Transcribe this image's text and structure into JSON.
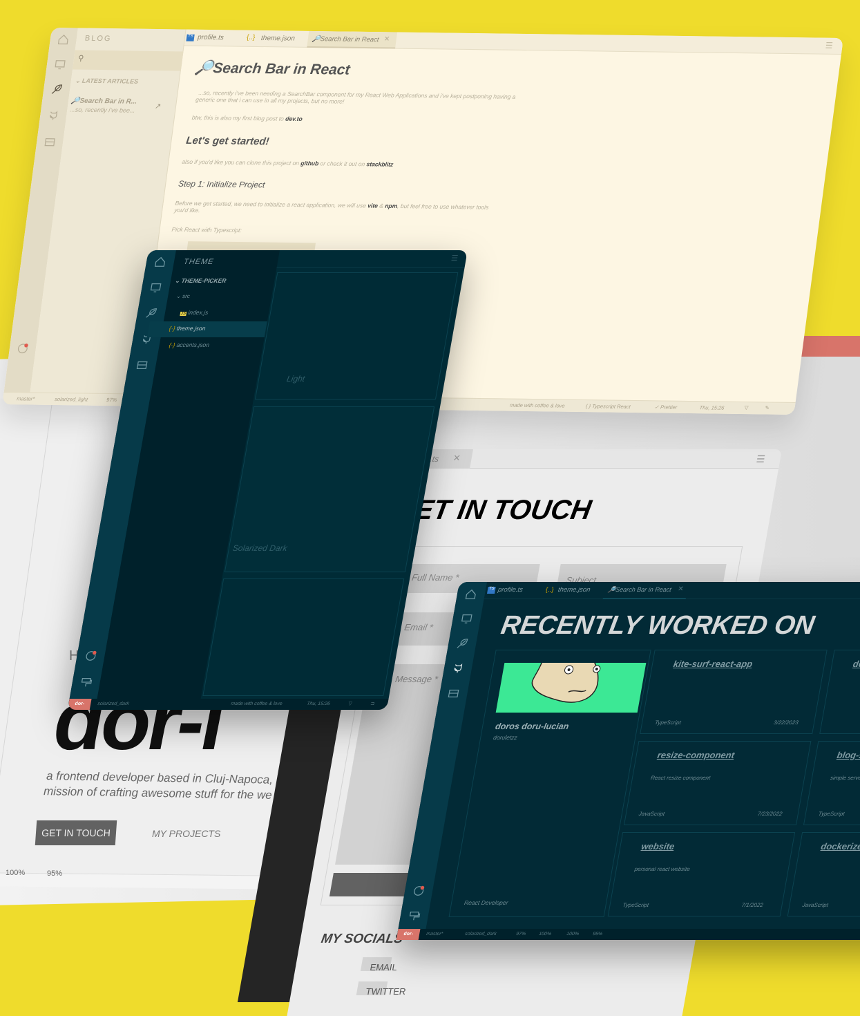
{
  "blog_window": {
    "sidebar_title": "BLOG",
    "section": "LATEST ARTICLES",
    "article": {
      "title": "Search Bar in R...",
      "excerpt": "...so, recently i've bee..."
    },
    "tabs": [
      {
        "label": "profile.ts"
      },
      {
        "label": "theme.json"
      },
      {
        "label": "Search Bar in React"
      }
    ],
    "title": "Search Bar in React",
    "intro": "...so, recently i've been needing a SearchBar component for my React Web Applications and i've kept postponing having a",
    "intro2": "generic one that i can use in all my projects, but no more!",
    "btw": "btw, this is also my first blog post to",
    "btw_link": "dev.to",
    "h2": "Let's get started!",
    "clone_a": "also if you'd like you can clone this project on",
    "clone_link1": "github",
    "clone_b": "or check it out on",
    "clone_link2": "stackblitz",
    "h3": "Step 1: Initialize Project",
    "before_a": "Before we get started, we need to initialize a react application, we will use",
    "before_vite": "vite",
    "before_amp": "&",
    "before_npm": "npm",
    "before_b": ", but feel free to use whatever tools",
    "before_c": "you'd like.",
    "pick": "Pick React with Typescript:",
    "status": {
      "branch": "master*",
      "theme": "solarized_light",
      "score": "97%",
      "made": "made with coffee & love",
      "lang": "{ } Typescript React",
      "formatter": "Prettier",
      "time": "Thu, 15:26"
    }
  },
  "theme_window": {
    "sidebar_title": "THEME",
    "folder": "THEME-PICKER",
    "subfolder": "src",
    "files": [
      {
        "label": "index.js"
      },
      {
        "label": "theme.json"
      },
      {
        "label": "accents.json"
      }
    ],
    "themes": [
      {
        "label": "Light"
      },
      {
        "label": "Solarized Dark"
      }
    ],
    "status": {
      "badge": "dor-",
      "theme": "solarized_dark",
      "made": "made with coffee & love",
      "time": "Thu, 15:26"
    }
  },
  "home_window": {
    "greeting": "H",
    "name": "dor-l",
    "tagline1": "a frontend developer based in Cluj-Napoca, R",
    "tagline2": "mission of crafting awesome stuff for the we",
    "cta": "GET IN TOUCH",
    "projects": "MY PROJECTS",
    "status": [
      "100%",
      "95%"
    ]
  },
  "touch_window": {
    "tab": ".ts",
    "heading": "GET IN TOUCH",
    "fields": {
      "name": "Full Name *",
      "subject": "Subject",
      "email": "Email *",
      "message": "Message *"
    },
    "socials_title": "MY SOCIALS",
    "socials": [
      {
        "label": "EMAIL"
      },
      {
        "label": "TWITTER"
      }
    ]
  },
  "recent_window": {
    "tabs": [
      {
        "label": "profile.ts"
      },
      {
        "label": "theme.json"
      },
      {
        "label": "Search Bar in React"
      }
    ],
    "heading": "RECENTLY WORKED ON",
    "profile": {
      "name": "doros doru-lucian",
      "handle": "doruletzz",
      "role": "React Developer"
    },
    "repos": [
      {
        "name": "kite-surf-react-app",
        "desc": "",
        "lang": "TypeScript",
        "date": "3/22/2023"
      },
      {
        "name": "do",
        "desc": "",
        "lang": "",
        "date": ""
      },
      {
        "name": "resize-component",
        "desc": "React resize component",
        "lang": "JavaScript",
        "date": "7/23/2022"
      },
      {
        "name": "blog-s",
        "desc": "simple server",
        "lang": "TypeScript",
        "date": ""
      },
      {
        "name": "website",
        "desc": "personal react website",
        "lang": "TypeScript",
        "date": "7/1/2022"
      },
      {
        "name": "dockerize",
        "desc": "",
        "lang": "JavaScript",
        "date": ""
      }
    ],
    "status": {
      "badge": "dor-",
      "branch": "master*",
      "theme": "solarized_dark",
      "scores": [
        "97%",
        "100%",
        "100%",
        "95%"
      ]
    }
  },
  "colors": {
    "background": "#efdc2c",
    "solarized_dark": "#002b36",
    "solarized_light": "#fdf6e3",
    "accent": "#d8746a",
    "avatar_bg": "#3ce895"
  }
}
